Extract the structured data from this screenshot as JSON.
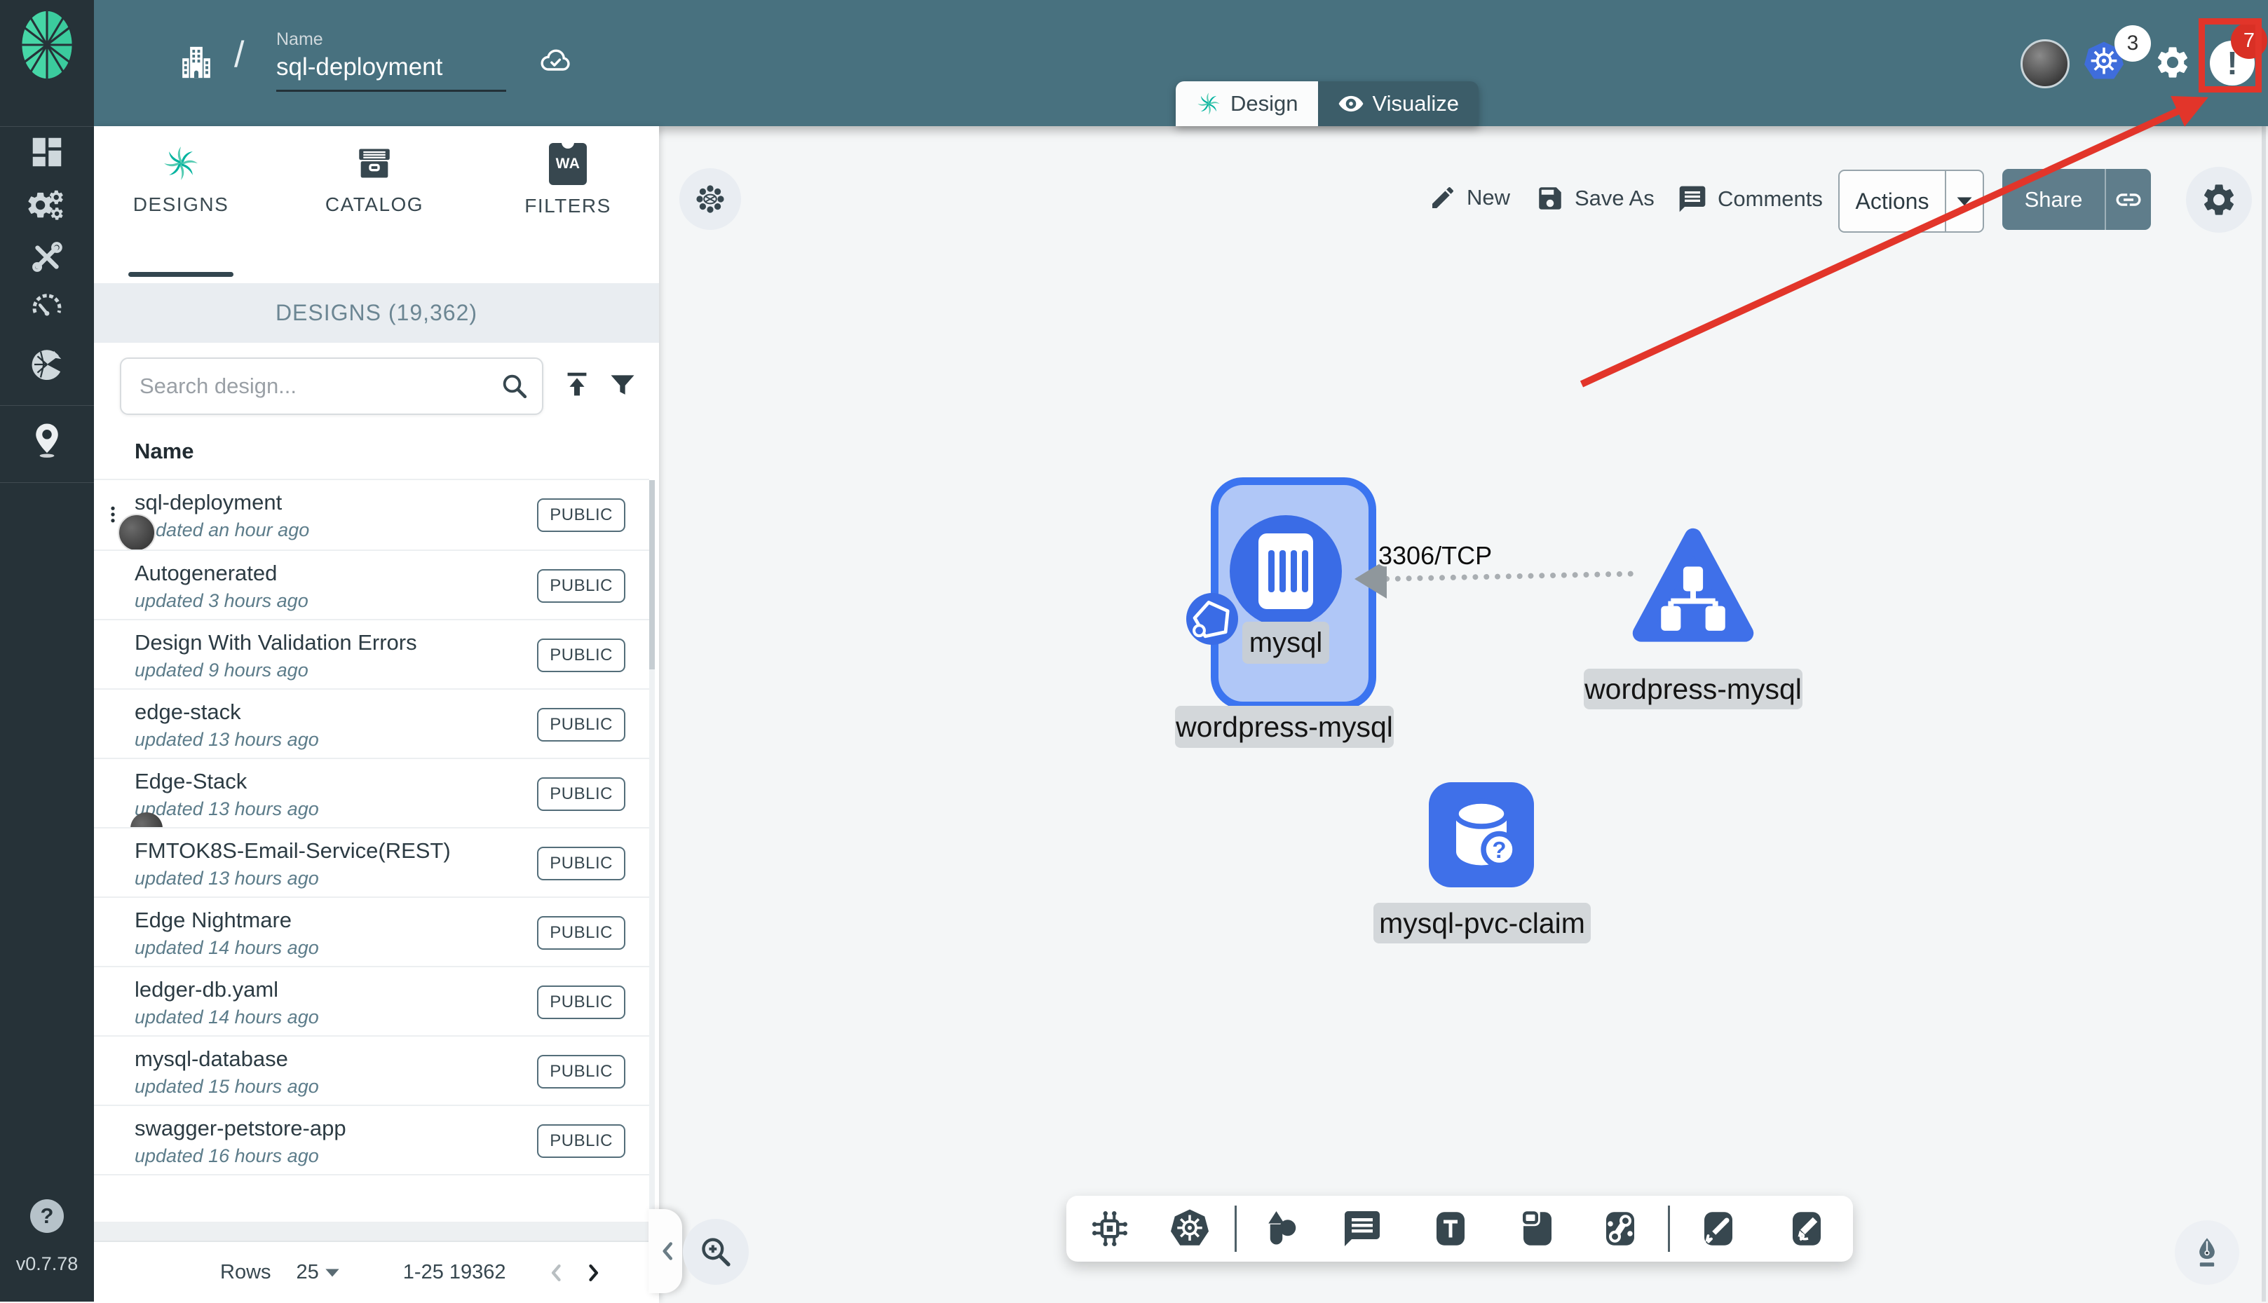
{
  "header": {
    "slash": "/",
    "name_label": "Name",
    "design_name": "sql-deployment",
    "k8s_context_count": "3",
    "notification_count": "7",
    "notification_glyph": "!"
  },
  "mode_tabs": {
    "design": "Design",
    "visualize": "Visualize"
  },
  "sidebar": {
    "help": "?",
    "version": "v0.7.78"
  },
  "panel": {
    "tabs": {
      "designs": "DESIGNS",
      "catalog": "CATALOG",
      "filters": "FILTERS"
    },
    "filters_icon_text": "WA",
    "banner": "DESIGNS (19,362)",
    "search_placeholder": "Search design...",
    "column_name": "Name",
    "rows": [
      {
        "name": "sql-deployment",
        "updated": "updated an hour ago",
        "visibility": "PUBLIC"
      },
      {
        "name": "Autogenerated",
        "updated": "updated 3 hours ago",
        "visibility": "PUBLIC"
      },
      {
        "name": "Design With Validation Errors",
        "updated": "updated 9 hours ago",
        "visibility": "PUBLIC"
      },
      {
        "name": "edge-stack",
        "updated": "updated 13 hours ago",
        "visibility": "PUBLIC"
      },
      {
        "name": "Edge-Stack",
        "updated": "updated 13 hours ago",
        "visibility": "PUBLIC"
      },
      {
        "name": "FMTOK8S-Email-Service(REST)",
        "updated": "updated 13 hours ago",
        "visibility": "PUBLIC"
      },
      {
        "name": "Edge Nightmare",
        "updated": "updated 14 hours ago",
        "visibility": "PUBLIC"
      },
      {
        "name": "ledger-db.yaml",
        "updated": "updated 14 hours ago",
        "visibility": "PUBLIC"
      },
      {
        "name": "mysql-database",
        "updated": "updated 15 hours ago",
        "visibility": "PUBLIC"
      },
      {
        "name": "swagger-petstore-app",
        "updated": "updated 16 hours ago",
        "visibility": "PUBLIC"
      }
    ],
    "pagination": {
      "rows_label": "Rows",
      "per_page": "25",
      "range": "1-25 19362"
    }
  },
  "canvas_toolbar": {
    "new": "New",
    "save_as": "Save As",
    "comments": "Comments",
    "actions": "Actions",
    "share": "Share"
  },
  "canvas": {
    "edge_label": "3306/TCP",
    "deployment": {
      "inner_label": "mysql",
      "label": "wordpress-mysql"
    },
    "service": {
      "label": "wordpress-mysql"
    },
    "pvc": {
      "label": "mysql-pvc-claim",
      "badge": "?"
    }
  },
  "colors": {
    "header_teal": "#48717f",
    "sidebar_dark": "#263238",
    "brand_green": "#00b39f",
    "node_blue": "#3f70e9",
    "node_fill_light": "#b0c7f7",
    "share_button": "#5f7d8b",
    "annotation_red": "#e2352a",
    "notification_badge_red": "#d93025"
  }
}
